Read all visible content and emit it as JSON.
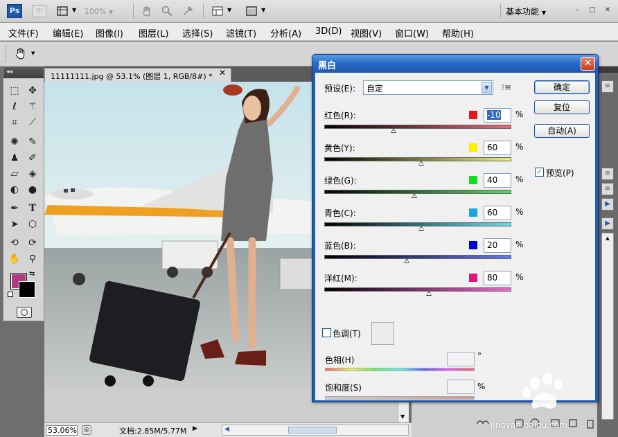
{
  "app": {
    "logo": "Ps",
    "bridge_label": "Br",
    "zoom_preset": "100%",
    "workspace": "基本功能",
    "window_controls": [
      "–",
      "□",
      "✕"
    ]
  },
  "menu": [
    "文件(F)",
    "编辑(E)",
    "图像(I)",
    "图层(L)",
    "选择(S)",
    "滤镜(T)",
    "分析(A)",
    "3D(D)",
    "视图(V)",
    "窗口(W)",
    "帮助(H)"
  ],
  "document": {
    "tab_title": "11111111.jpg @ 53.1% (图层 1, RGB/8#) *",
    "close": "✕",
    "zoom_level": "53.06%",
    "doc_size": "文档:2.85M/5.77M"
  },
  "colors": {
    "foreground": "#b13a83",
    "background": "#000000",
    "accent": "#1f5fb8"
  },
  "dialog": {
    "title": "黑白",
    "close": "✕",
    "preset_label": "预设(E):",
    "preset_value": "自定",
    "buttons": {
      "ok": "确定",
      "reset": "复位",
      "auto": "自动(A)"
    },
    "preview": {
      "label": "预览(P)",
      "checked": true
    },
    "sliders": [
      {
        "label": "红色(R):",
        "value": "-10",
        "percent": "%",
        "swatch": "#e8141c",
        "fraction": 0.37,
        "track": "linear-gradient(90deg,#000,#ee6677)"
      },
      {
        "label": "黄色(Y):",
        "value": "60",
        "percent": "%",
        "swatch": "#ffee00",
        "fraction": 0.52,
        "track": "linear-gradient(90deg,#000,#eeee77)"
      },
      {
        "label": "绿色(G):",
        "value": "40",
        "percent": "%",
        "swatch": "#11dd22",
        "fraction": 0.48,
        "track": "linear-gradient(90deg,#000,#55dd66)"
      },
      {
        "label": "青色(C):",
        "value": "60",
        "percent": "%",
        "swatch": "#14a6dc",
        "fraction": 0.52,
        "track": "linear-gradient(90deg,#000,#66ddee)"
      },
      {
        "label": "蓝色(B):",
        "value": "20",
        "percent": "%",
        "swatch": "#0000dd",
        "fraction": 0.44,
        "track": "linear-gradient(90deg,#000,#6677ee)"
      },
      {
        "label": "洋红(M):",
        "value": "80",
        "percent": "%",
        "swatch": "#e0157a",
        "fraction": 0.56,
        "track": "linear-gradient(90deg,#000,#ee66cc)"
      }
    ],
    "tint": {
      "label": "色调(T)",
      "checked": false
    },
    "hue": {
      "label": "色相(H)",
      "unit": "°"
    },
    "saturation": {
      "label": "饱和度(S)",
      "unit": "%"
    }
  },
  "watermark": {
    "text": "jingyan.baidu.com"
  }
}
